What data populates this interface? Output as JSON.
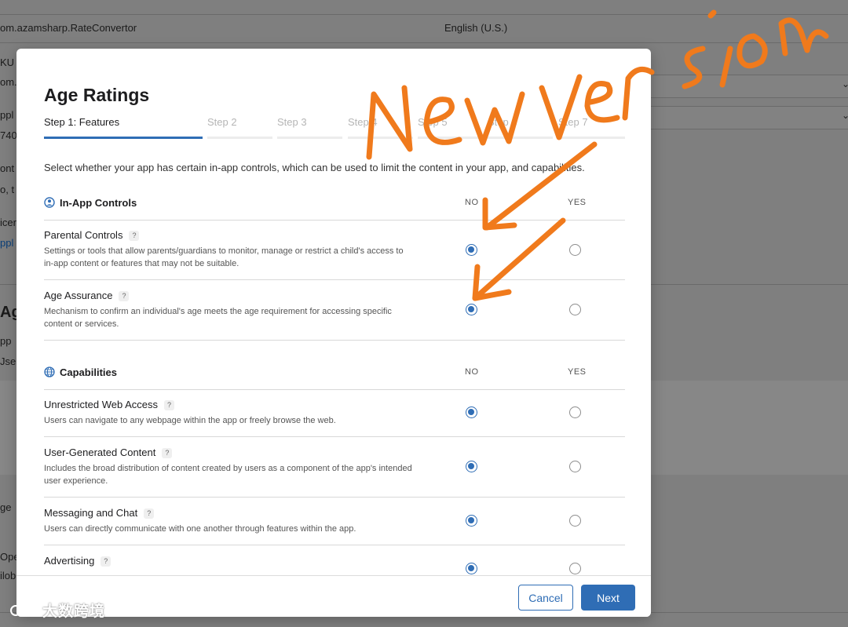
{
  "background": {
    "bundle_id": "om.azamsharp.RateConvertor",
    "language": "English (U.S.)",
    "frag_sku": "KU",
    "frag_om": "om.",
    "frag_appl": "ppl",
    "frag_740": "740",
    "frag_cont": "ont",
    "frag_do": "o, t",
    "frag_licen": "icer",
    "frag_appl_link": "ppl",
    "frag_age_heading": "Ag",
    "frag_app": "pp",
    "frag_user": "Jser",
    "frag_age": "ge",
    "frag_oper": "Oper",
    "frag_glob": "ilob"
  },
  "modal": {
    "title": "Age Ratings",
    "steps": [
      {
        "label": "Step 1: Features",
        "active": true
      },
      {
        "label": "Step 2",
        "active": false
      },
      {
        "label": "Step 3",
        "active": false
      },
      {
        "label": "Step 4",
        "active": false
      },
      {
        "label": "Step 5",
        "active": false
      },
      {
        "label": "Step 6",
        "active": false
      },
      {
        "label": "Step 7",
        "active": false
      }
    ],
    "intro": "Select whether your app has certain in-app controls, which can be used to limit the content in your app, and capabilities.",
    "col_no": "NO",
    "col_yes": "YES",
    "help_glyph": "?",
    "sections": [
      {
        "title": "In-App Controls",
        "icon": "person-circle-icon",
        "rows": [
          {
            "label": "Parental Controls",
            "desc": "Settings or tools that allow parents/guardians to monitor, manage or restrict a child's access to in-app content or features that may not be suitable.",
            "selected": "NO"
          },
          {
            "label": "Age Assurance",
            "desc": "Mechanism to confirm an individual's age meets the age requirement for accessing specific content or services.",
            "selected": "NO"
          }
        ]
      },
      {
        "title": "Capabilities",
        "icon": "globe-icon",
        "rows": [
          {
            "label": "Unrestricted Web Access",
            "desc": "Users can navigate to any webpage within the app or freely browse the web.",
            "selected": "NO"
          },
          {
            "label": "User-Generated Content",
            "desc": "Includes the broad distribution of content created by users as a component of the app's intended user experience.",
            "selected": "NO"
          },
          {
            "label": "Messaging and Chat",
            "desc": "Users can directly communicate with one another through features within the app.",
            "selected": "NO"
          },
          {
            "label": "Advertising",
            "desc": "",
            "selected": "NO"
          }
        ]
      }
    ],
    "buttons": {
      "cancel": "Cancel",
      "next": "Next"
    }
  },
  "annotation": {
    "handwriting": "New version",
    "color": "#f07a1c"
  },
  "colors": {
    "accent": "#2f6db5"
  },
  "watermark": {
    "text": "大数跨境"
  }
}
